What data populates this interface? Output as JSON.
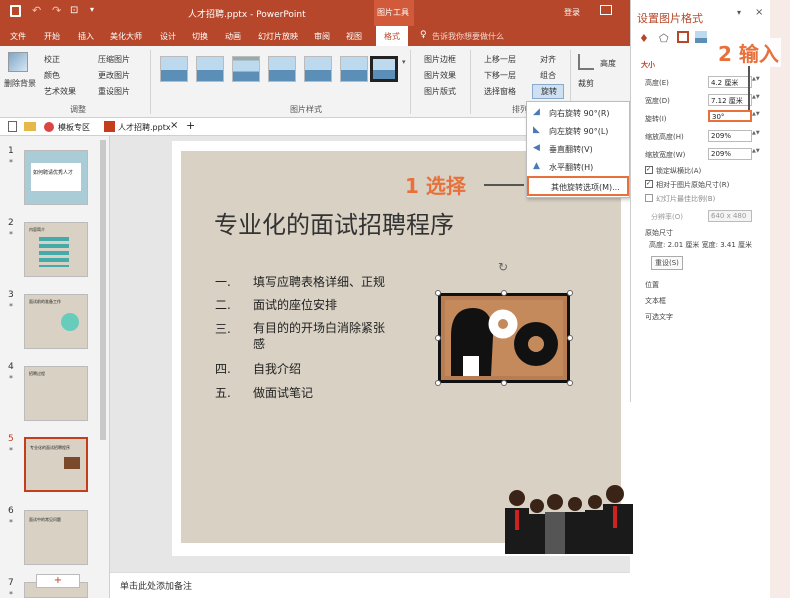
{
  "titlebar": {
    "save_icon": "save-icon",
    "filename": "人才招聘.pptx - PowerPoint",
    "tool_context": "图片工具",
    "login": "登录"
  },
  "tabs": [
    "文件",
    "开始",
    "插入",
    "美化大师",
    "设计",
    "切换",
    "动画",
    "幻灯片放映",
    "审阅",
    "视图",
    "格式"
  ],
  "active_tab": "格式",
  "tell_me": "告诉我你想要做什么",
  "ribbon": {
    "remove_bg": "删除背景",
    "adjust": [
      "校正",
      "颜色",
      "艺术效果"
    ],
    "compress": [
      "压缩图片",
      "更改图片",
      "重设图片"
    ],
    "adjust_label": "调整",
    "styles_label": "图片样式",
    "pic_options": [
      "图片边框",
      "图片效果",
      "图片版式"
    ],
    "arrange": [
      "上移一层",
      "下移一层",
      "选择窗格"
    ],
    "arrange2": [
      "对齐",
      "组合",
      "旋转"
    ],
    "arrange_label": "排列",
    "crop": "裁剪",
    "size_label": "高度"
  },
  "doctabs": {
    "template": "模板专区",
    "file": "人才招聘.pptx",
    "close": "×",
    "add": "+"
  },
  "rotate_menu": [
    "向右旋转 90°(R)",
    "向左旋转 90°(L)",
    "垂直翻转(V)",
    "水平翻转(H)",
    "其他旋转选项(M)..."
  ],
  "slides": [
    {
      "num": "1",
      "star": "*",
      "title": "如何聘请优秀人才"
    },
    {
      "num": "2",
      "star": "*",
      "title": "内容简介"
    },
    {
      "num": "3",
      "star": "*",
      "title": "面试前的准备工作"
    },
    {
      "num": "4",
      "star": "*",
      "title": "招聘过程"
    },
    {
      "num": "5",
      "star": "*",
      "title": "专业化的面试招聘程序"
    },
    {
      "num": "6",
      "star": "*",
      "title": "面试中的常见问题"
    },
    {
      "num": "7",
      "star": "*",
      "title": ""
    }
  ],
  "new_slide": "+",
  "slide_main": {
    "title": "专业化的面试招聘程序",
    "bullets": [
      {
        "n": "一.",
        "t": "填写应聘表格详细、正规"
      },
      {
        "n": "二.",
        "t": "面试的座位安排"
      },
      {
        "n": "三.",
        "t": "有目的的开场白消除紧张感"
      },
      {
        "n": "四.",
        "t": "自我介绍"
      },
      {
        "n": "五.",
        "t": "做面试笔记"
      }
    ]
  },
  "notes": "单击此处添加备注",
  "callouts": {
    "step1": "1 选择",
    "step2": "2 输入"
  },
  "format_panel": {
    "title": "设置图片格式",
    "section_size": "大小",
    "height_label": "高度(E)",
    "height_val": "4.2 厘米",
    "width_label": "宽度(D)",
    "width_val": "7.12 厘米",
    "rotation_label": "旋转(I)",
    "rotation_val": "30°",
    "scale_h_label": "缩放高度(H)",
    "scale_h_val": "209%",
    "scale_w_label": "缩放宽度(W)",
    "scale_w_val": "209%",
    "lock_ratio": "锁定纵横比(A)",
    "relative": "相对于图片原始尺寸(R)",
    "best_scale": "幻灯片最佳比例(B)",
    "resolution_label": "分辨率(O)",
    "resolution_val": "640 x 480",
    "original_size": "原始尺寸",
    "original_vals": "高度: 2.01 厘米   宽度: 3.41 厘米",
    "reset": "重设(S)",
    "sections": [
      "位置",
      "文本框",
      "可选文字"
    ]
  },
  "colors": {
    "accent": "#b7472a",
    "callout": "#e8703a",
    "slide_bg": "#d8d1c4"
  }
}
